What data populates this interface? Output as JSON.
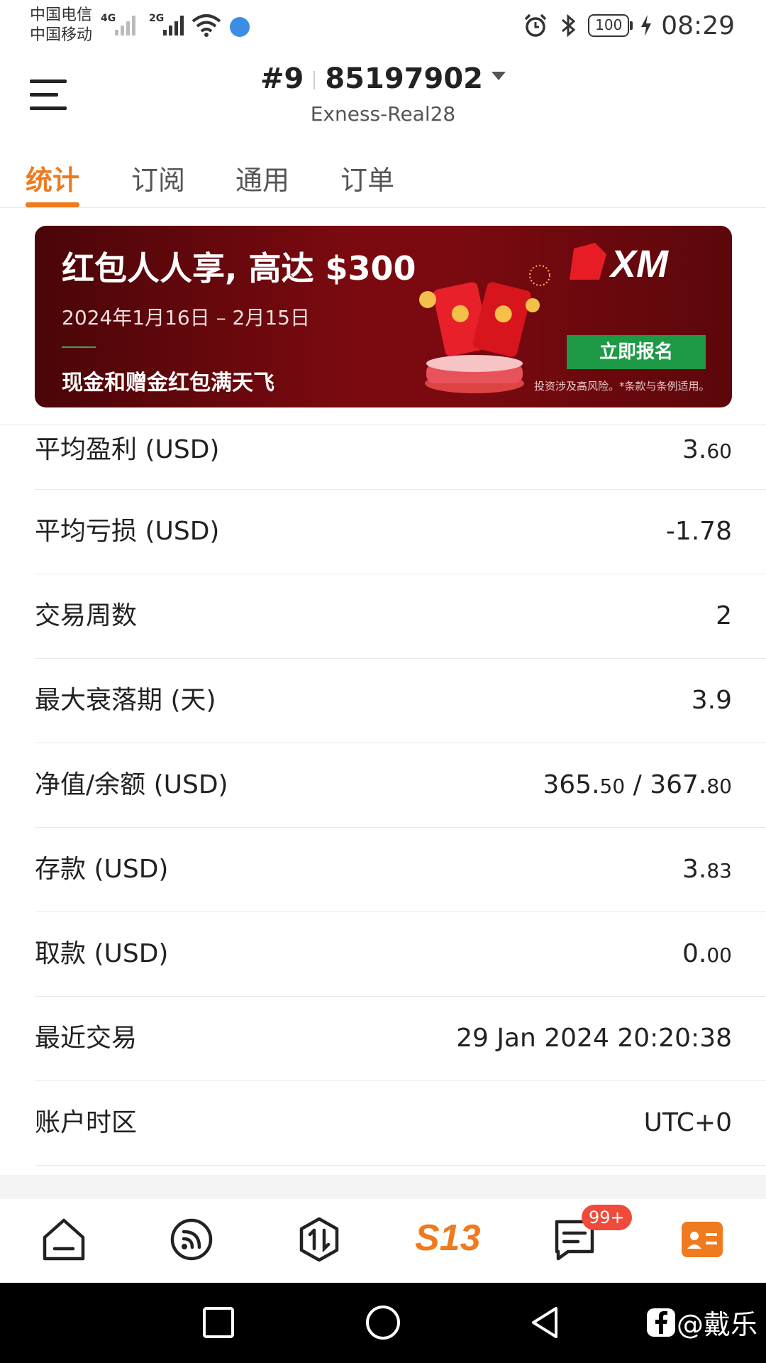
{
  "status_bar": {
    "carrier_1": "中国电信",
    "carrier_2": "中国移动",
    "network_1": "4G",
    "network_2": "2G",
    "battery": "100",
    "time": "08:29"
  },
  "header": {
    "account_rank": "#9",
    "account_number": "85197902",
    "server": "Exness-Real28"
  },
  "tabs": [
    {
      "label": "统计",
      "active": true
    },
    {
      "label": "订阅",
      "active": false
    },
    {
      "label": "通用",
      "active": false
    },
    {
      "label": "订单",
      "active": false
    }
  ],
  "banner": {
    "title": "红包人人享, 高达 $300",
    "date_range": "2024年1月16日 – 2月15日",
    "subtitle": "现金和赠金红包满天飞",
    "brand": "XM",
    "button_label": "立即报名",
    "risk_note": "投资涉及高风险。*条款与条例适用。",
    "brand_color": "#7a0a10",
    "button_color": "#1e9a47"
  },
  "stats": [
    {
      "label": "平均盈利 (USD)",
      "value_main": "3.",
      "value_small": "60"
    },
    {
      "label": "平均亏损 (USD)",
      "value_main": "-1.78",
      "value_small": ""
    },
    {
      "label": "交易周数",
      "value_main": "2",
      "value_small": ""
    },
    {
      "label": "最大衰落期 (天)",
      "value_main": "3.9",
      "value_small": ""
    },
    {
      "label": "净值/余额 (USD)",
      "value_main": "365.",
      "value_small": "50",
      "value_main_2": " / 367.",
      "value_small_2": "80"
    },
    {
      "label": "存款 (USD)",
      "value_main": "3.",
      "value_small": "83"
    },
    {
      "label": "取款 (USD)",
      "value_main": "0.",
      "value_small": "00"
    },
    {
      "label": "最近交易",
      "value_main": "29 Jan 2024 20:20:38",
      "value_small": ""
    },
    {
      "label": "账户时区",
      "value_main": "UTC+0",
      "value_small": ""
    }
  ],
  "bottom_nav": {
    "items": [
      "home-icon",
      "signals-icon",
      "trade-icon",
      "s13-icon",
      "messages-icon",
      "profile-card-icon"
    ],
    "logo_text": "S13",
    "messages_badge": "99+",
    "accent_color": "#f07a1e"
  },
  "watermark": {
    "text": "@戴乐"
  }
}
